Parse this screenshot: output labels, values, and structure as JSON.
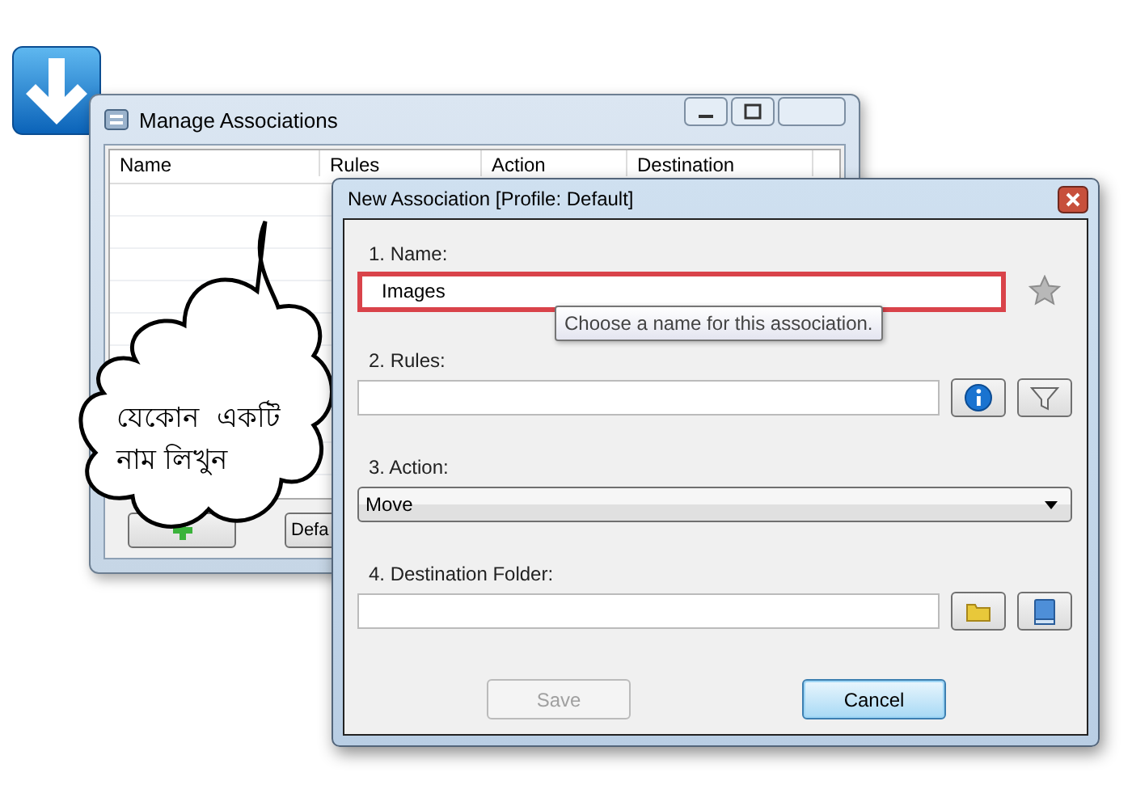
{
  "manage_window": {
    "title": "Manage Associations",
    "columns": [
      "Name",
      "Rules",
      "Action",
      "Destination"
    ],
    "default_button": "Defa"
  },
  "dialog": {
    "title": "New Association [Profile: Default]",
    "name": {
      "label": "1. Name:",
      "value": "Images",
      "highlighted": true,
      "tooltip": "Choose a name for this association."
    },
    "rules": {
      "label": "2. Rules:"
    },
    "action": {
      "label": "3. Action:",
      "value": "Move"
    },
    "destination": {
      "label": "4. Destination Folder:"
    },
    "buttons": [
      {
        "label": "Save",
        "disabled": true,
        "focused": false
      },
      {
        "label": "Cancel",
        "disabled": false,
        "focused": true
      }
    ]
  },
  "callout": {
    "lines": [
      "যেকোন  একটি",
      "নাম লিখুন"
    ]
  }
}
